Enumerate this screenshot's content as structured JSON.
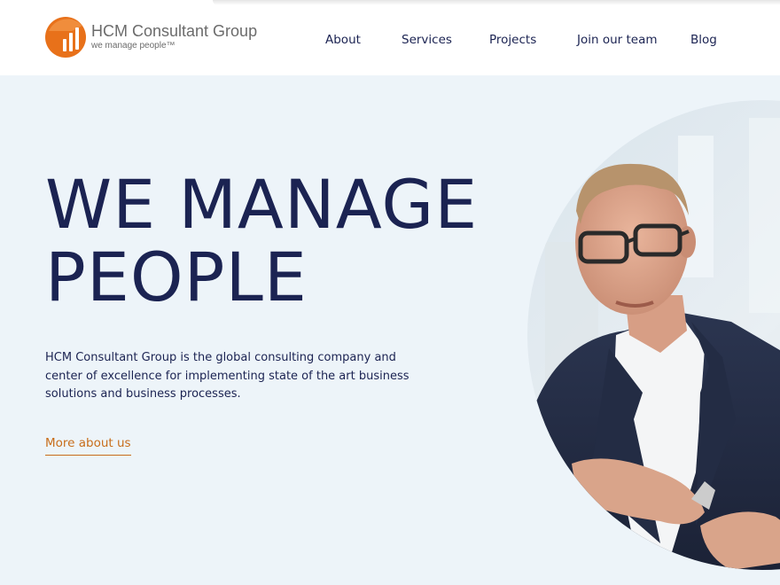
{
  "brand": {
    "name": "HCM Consultant Group",
    "tagline": "we manage people™",
    "logo_color": "#e8711a"
  },
  "nav": {
    "items": [
      {
        "label": "About"
      },
      {
        "label": "Services"
      },
      {
        "label": "Projects"
      },
      {
        "label": "Join our team"
      },
      {
        "label": "Blog"
      }
    ]
  },
  "hero": {
    "title_line1": "WE MANAGE",
    "title_line2": "PEOPLE",
    "description": "HCM Consultant Group is the global consulting company and center of excellence for implementing state of the art business solutions and business processes.",
    "cta_label": "More about us",
    "photo_icon": "portrait-photo"
  },
  "colors": {
    "primary_text": "#1b2352",
    "accent": "#c86d1a",
    "hero_background": "#edf4f9"
  }
}
